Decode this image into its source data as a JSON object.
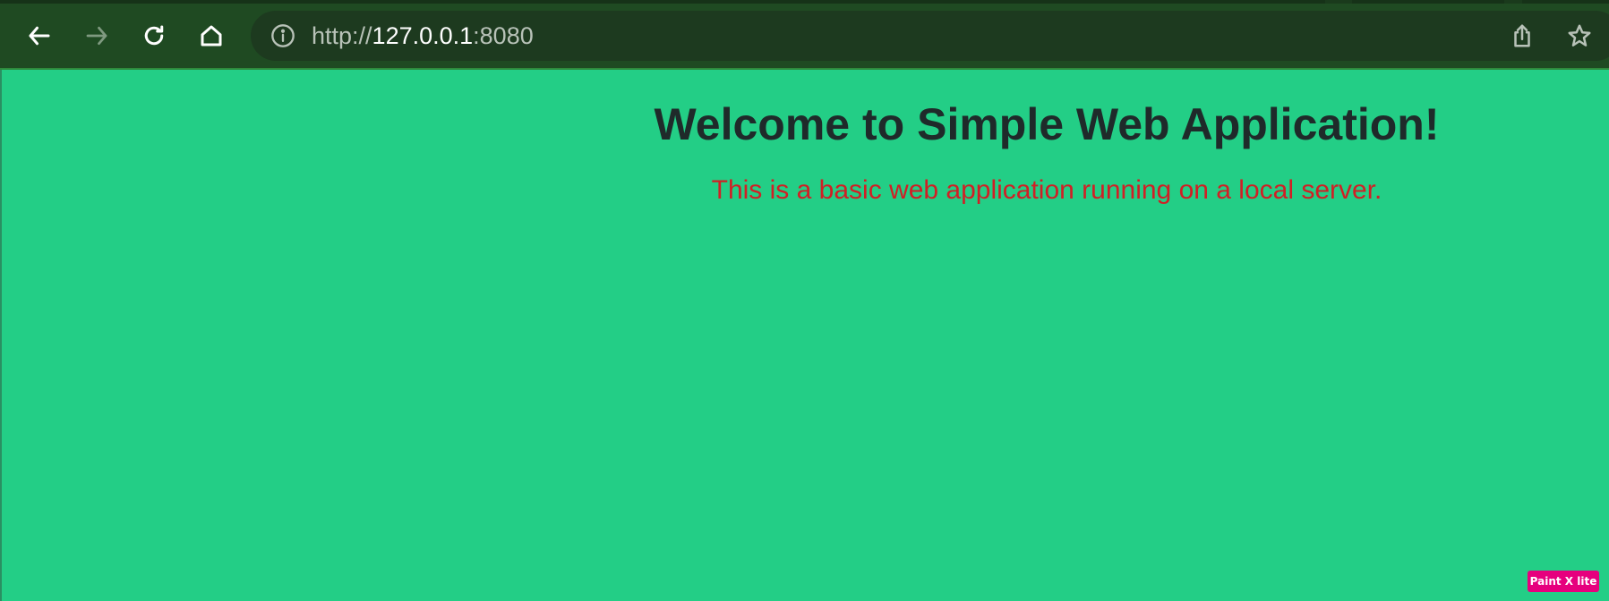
{
  "browser": {
    "nav": {
      "back_icon": "arrow-left-icon",
      "forward_icon": "arrow-right-icon",
      "reload_icon": "reload-icon",
      "home_icon": "home-icon"
    },
    "address_bar": {
      "info_icon": "info-icon",
      "url_scheme": "http://",
      "url_host": "127.0.0.1",
      "url_port": ":8080"
    },
    "actions": {
      "share_icon": "share-icon",
      "bookmark_icon": "star-icon"
    },
    "colors": {
      "toolbar_bg": "#1f4a22",
      "omnibox_bg": "#1d3a1f"
    }
  },
  "page": {
    "heading": "Welcome to Simple Web Application!",
    "subtext": "This is a basic web application running on a local server.",
    "colors": {
      "background": "#23ce86",
      "heading": "#1f2a2a",
      "subtext": "#d11f25"
    }
  },
  "watermark": {
    "label": "Paint X lite",
    "color": "#e6007e"
  }
}
